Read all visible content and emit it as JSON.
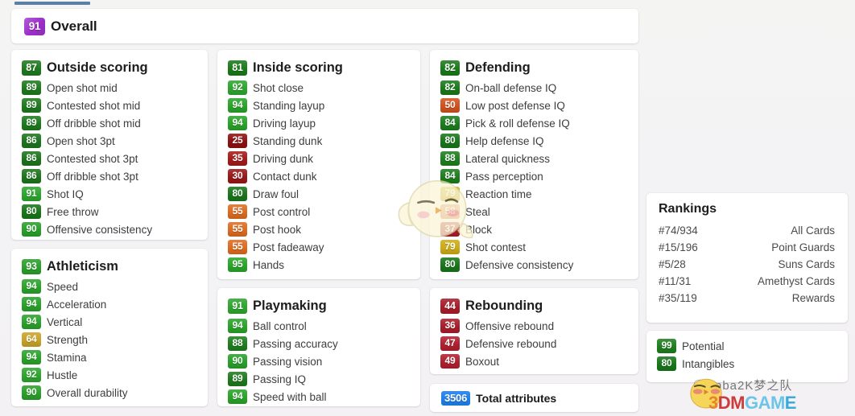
{
  "overall": {
    "value": "91",
    "label": "Overall",
    "color": "#9b2fc9"
  },
  "groups": [
    {
      "id": "outside-scoring",
      "header": {
        "value": "87",
        "label": "Outside scoring",
        "color": "#1f7a1f"
      },
      "items": [
        {
          "value": "89",
          "label": "Open shot mid",
          "color": "#1f7a1f"
        },
        {
          "value": "89",
          "label": "Contested shot mid",
          "color": "#1f7a1f"
        },
        {
          "value": "89",
          "label": "Off dribble shot mid",
          "color": "#1f7a1f"
        },
        {
          "value": "86",
          "label": "Open shot 3pt",
          "color": "#1d751d"
        },
        {
          "value": "86",
          "label": "Contested shot 3pt",
          "color": "#1d751d"
        },
        {
          "value": "86",
          "label": "Off dribble shot 3pt",
          "color": "#1d751d"
        },
        {
          "value": "91",
          "label": "Shot IQ",
          "color": "#2ea62e"
        },
        {
          "value": "80",
          "label": "Free throw",
          "color": "#19761a"
        },
        {
          "value": "90",
          "label": "Offensive consistency",
          "color": "#2aa02a"
        }
      ]
    },
    {
      "id": "athleticism",
      "header": {
        "value": "93",
        "label": "Athleticism",
        "color": "#2aa02a"
      },
      "items": [
        {
          "value": "94",
          "label": "Speed",
          "color": "#2aa32a"
        },
        {
          "value": "94",
          "label": "Acceleration",
          "color": "#2aa32a"
        },
        {
          "value": "94",
          "label": "Vertical",
          "color": "#2aa32a"
        },
        {
          "value": "64",
          "label": "Strength",
          "color": "#c9a227"
        },
        {
          "value": "94",
          "label": "Stamina",
          "color": "#2aa32a"
        },
        {
          "value": "92",
          "label": "Hustle",
          "color": "#2ea62e"
        },
        {
          "value": "90",
          "label": "Overall durability",
          "color": "#2aa02a"
        }
      ]
    },
    {
      "id": "inside-scoring",
      "header": {
        "value": "81",
        "label": "Inside scoring",
        "color": "#1a7a1a"
      },
      "items": [
        {
          "value": "92",
          "label": "Shot close",
          "color": "#2ea62e"
        },
        {
          "value": "94",
          "label": "Standing layup",
          "color": "#2aa32a"
        },
        {
          "value": "94",
          "label": "Driving layup",
          "color": "#2aa32a"
        },
        {
          "value": "25",
          "label": "Standing dunk",
          "color": "#8e1111"
        },
        {
          "value": "35",
          "label": "Driving dunk",
          "color": "#a51a1a"
        },
        {
          "value": "30",
          "label": "Contact dunk",
          "color": "#991717"
        },
        {
          "value": "80",
          "label": "Draw foul",
          "color": "#19761a"
        },
        {
          "value": "55",
          "label": "Post control",
          "color": "#dd6b20"
        },
        {
          "value": "55",
          "label": "Post hook",
          "color": "#dd6b20"
        },
        {
          "value": "55",
          "label": "Post fadeaway",
          "color": "#dd6b20"
        },
        {
          "value": "95",
          "label": "Hands",
          "color": "#2aa52a"
        }
      ]
    },
    {
      "id": "playmaking",
      "header": {
        "value": "91",
        "label": "Playmaking",
        "color": "#2ea62e"
      },
      "items": [
        {
          "value": "94",
          "label": "Ball control",
          "color": "#2aa32a"
        },
        {
          "value": "88",
          "label": "Passing accuracy",
          "color": "#1f7f1f"
        },
        {
          "value": "90",
          "label": "Passing vision",
          "color": "#2aa02a"
        },
        {
          "value": "89",
          "label": "Passing IQ",
          "color": "#1f7a1f"
        },
        {
          "value": "94",
          "label": "Speed with ball",
          "color": "#2aa32a"
        }
      ]
    },
    {
      "id": "defending",
      "header": {
        "value": "82",
        "label": "Defending",
        "color": "#1b7a1b"
      },
      "items": [
        {
          "value": "82",
          "label": "On-ball defense IQ",
          "color": "#1b7a1b"
        },
        {
          "value": "50",
          "label": "Low post defense IQ",
          "color": "#d1511f"
        },
        {
          "value": "84",
          "label": "Pick & roll defense IQ",
          "color": "#1d7d1d"
        },
        {
          "value": "80",
          "label": "Help defense IQ",
          "color": "#19761a"
        },
        {
          "value": "88",
          "label": "Lateral quickness",
          "color": "#1f7f1f"
        },
        {
          "value": "84",
          "label": "Pass perception",
          "color": "#1d7d1d"
        },
        {
          "value": "79",
          "label": "Reaction time",
          "color": "#ccab16"
        },
        {
          "value": "58",
          "label": "Steal",
          "color": "#e07b4a"
        },
        {
          "value": "37",
          "label": "Block",
          "color": "#a81e2a"
        },
        {
          "value": "79",
          "label": "Shot contest",
          "color": "#ccab16"
        },
        {
          "value": "80",
          "label": "Defensive consistency",
          "color": "#19761a"
        }
      ]
    },
    {
      "id": "rebounding",
      "header": {
        "value": "44",
        "label": "Rebounding",
        "color": "#a81d2a"
      },
      "items": [
        {
          "value": "36",
          "label": "Offensive rebound",
          "color": "#a81d2a"
        },
        {
          "value": "47",
          "label": "Defensive rebound",
          "color": "#b02030"
        },
        {
          "value": "49",
          "label": "Boxout",
          "color": "#b02030"
        }
      ]
    }
  ],
  "total": {
    "value": "3506",
    "label": "Total attributes",
    "color": "#1d7ee8"
  },
  "rankings": {
    "title": "Rankings",
    "rows": [
      {
        "rank": "#74/934",
        "name": "All Cards"
      },
      {
        "rank": "#15/196",
        "name": "Point Guards"
      },
      {
        "rank": "#5/28",
        "name": "Suns Cards"
      },
      {
        "rank": "#11/31",
        "name": "Amethyst Cards"
      },
      {
        "rank": "#35/119",
        "name": "Rewards"
      }
    ]
  },
  "extras": [
    {
      "value": "99",
      "label": "Potential",
      "color": "#1f7f1f"
    },
    {
      "value": "80",
      "label": "Intangibles",
      "color": "#19761a"
    }
  ],
  "watermark": {
    "site_text": "nba2K梦之队",
    "brand_3dm": "3DMGAME"
  }
}
